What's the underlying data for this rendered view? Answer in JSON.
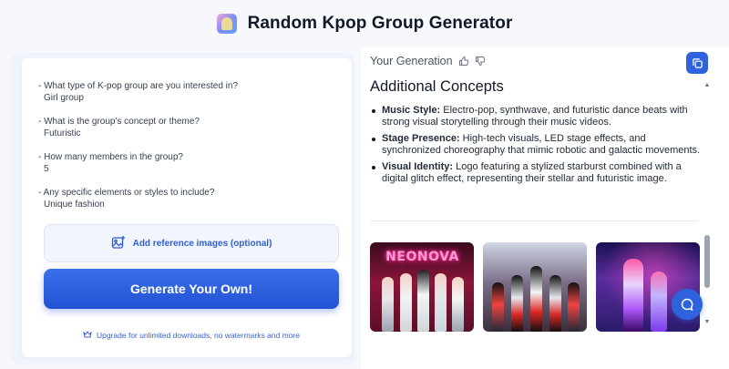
{
  "header": {
    "title": "Random Kpop Group Generator",
    "logo_icon": "kpop-avatar-icon"
  },
  "form": {
    "questions": [
      {
        "question": "- What type of K-pop group are you interested in?",
        "answer": "Girl group"
      },
      {
        "question": "- What is the group's concept or theme?",
        "answer": "Futuristic"
      },
      {
        "question": "- How many members in the group?",
        "answer": "5"
      },
      {
        "question": "- Any specific elements or styles to include?",
        "answer": "Unique fashion"
      }
    ],
    "reference_label": "Add reference images (optional)",
    "generate_label": "Generate Your Own!",
    "upgrade_text": "Upgrade for unlimited downloads, no watermarks and more"
  },
  "result": {
    "heading": "Your Generation",
    "section_title": "Additional Concepts",
    "bullets": [
      {
        "label": "Music Style:",
        "text": " Electro-pop, synthwave, and futuristic dance beats with strong visual storytelling through their music videos."
      },
      {
        "label": "Stage Presence:",
        "text": " High-tech visuals, LED stage effects, and synchronized choreography that mimic robotic and galactic movements."
      },
      {
        "label": "Visual Identity:",
        "text": " Logo featuring a stylized starburst combined with a digital glitch effect, representing their stellar and futuristic image."
      }
    ],
    "images": [
      {
        "caption": "NEONOVA"
      },
      {
        "caption": ""
      },
      {
        "caption": ""
      }
    ]
  },
  "colors": {
    "accent": "#2f63dd",
    "button_gradient_top": "#3b6fe8",
    "button_gradient_bottom": "#2252d4",
    "panel_bg": "#eef3fc"
  }
}
